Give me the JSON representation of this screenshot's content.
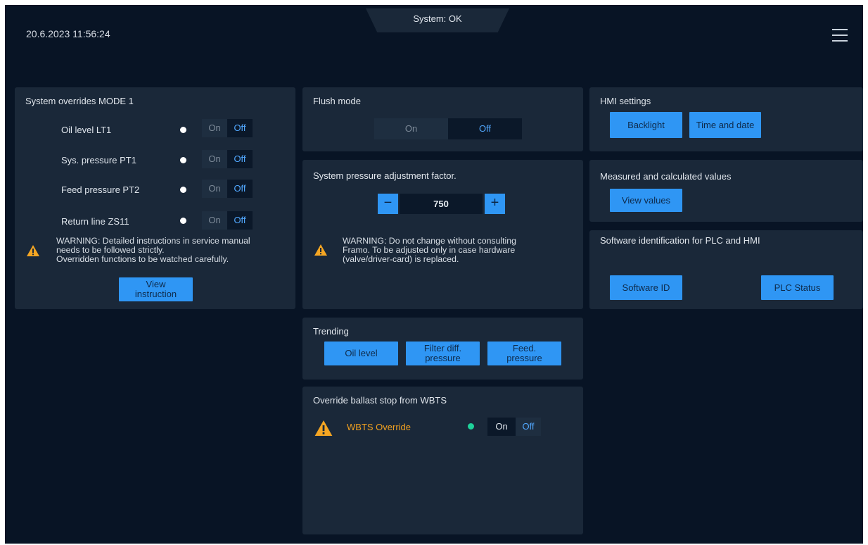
{
  "header": {
    "datetime": "20.6.2023 11:56:24",
    "status": "System: OK"
  },
  "overrides": {
    "title": "System overrides MODE 1",
    "rows": [
      {
        "label": "Oil level LT1",
        "on": "On",
        "off": "Off"
      },
      {
        "label": "Sys. pressure PT1",
        "on": "On",
        "off": "Off"
      },
      {
        "label": "Feed pressure PT2",
        "on": "On",
        "off": "Off"
      },
      {
        "label": "Return line ZS11",
        "on": "On",
        "off": "Off"
      }
    ],
    "warning_lines": [
      "WARNING: Detailed instructions in service manual",
      "needs to be followed strictly.",
      "Overridden functions to be watched carefully."
    ],
    "button_lines": [
      "View",
      "instruction"
    ]
  },
  "flush": {
    "title": "Flush mode",
    "on": "On",
    "off": "Off"
  },
  "pressure_factor": {
    "title": "System pressure adjustment factor.",
    "minus": "−",
    "value": "750",
    "plus": "+",
    "warning_lines": [
      "WARNING: Do not change without consulting",
      "Framo. To be adjusted only in case hardware",
      "(valve/driver-card) is replaced."
    ]
  },
  "trending": {
    "title": "Trending",
    "buttons": [
      {
        "lines": [
          "Oil level"
        ]
      },
      {
        "lines": [
          "Filter diff.",
          "pressure"
        ]
      },
      {
        "lines": [
          "Feed.",
          "pressure"
        ]
      }
    ]
  },
  "ballast": {
    "title": "Override ballast stop from WBTS",
    "label": "WBTS Override",
    "on": "On",
    "off": "Off",
    "label_color": "#f0a020",
    "dot_color": "#1ed29a"
  },
  "hmi": {
    "title": "HMI settings",
    "backlight": "Backlight",
    "time_date": "Time and date"
  },
  "measured": {
    "title": "Measured and calculated values",
    "view_values": "View values"
  },
  "software": {
    "title": "Software identification for PLC and HMI",
    "software_id": "Software ID",
    "plc_status": "PLC Status"
  },
  "colors": {
    "background": "#081425",
    "panel": "#1a2839",
    "accent": "#2f96f4",
    "warning": "#f5a623"
  }
}
